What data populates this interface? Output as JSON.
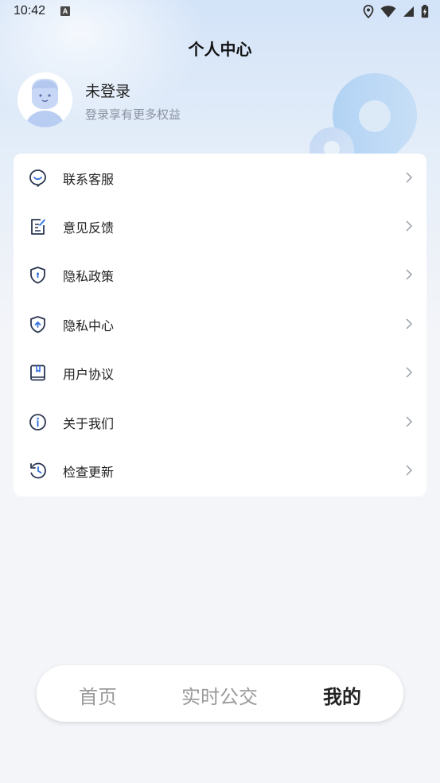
{
  "status_bar": {
    "time": "10:42",
    "notification_badge": "A",
    "icons": [
      "location-icon",
      "wifi-icon",
      "signal-icon",
      "battery-icon"
    ]
  },
  "page_title": "个人中心",
  "profile": {
    "name": "未登录",
    "subtitle": "登录享有更多权益"
  },
  "menu": [
    {
      "label": "联系客服",
      "icon": "customer-service-icon"
    },
    {
      "label": "意见反馈",
      "icon": "feedback-icon"
    },
    {
      "label": "隐私政策",
      "icon": "privacy-policy-shield-icon"
    },
    {
      "label": "隐私中心",
      "icon": "privacy-center-shield-icon"
    },
    {
      "label": "用户协议",
      "icon": "user-agreement-icon"
    },
    {
      "label": "关于我们",
      "icon": "info-icon"
    },
    {
      "label": "检查更新",
      "icon": "check-update-icon"
    }
  ],
  "bottom_nav": {
    "items": [
      {
        "label": "首页",
        "active": false
      },
      {
        "label": "实时公交",
        "active": false
      },
      {
        "label": "我的",
        "active": true
      }
    ]
  },
  "colors": {
    "accent": "#2f5fb0",
    "background": "#f3f5f9",
    "header_gradient": "#d3e3f8",
    "inactive_nav": "#9a9a9a"
  }
}
